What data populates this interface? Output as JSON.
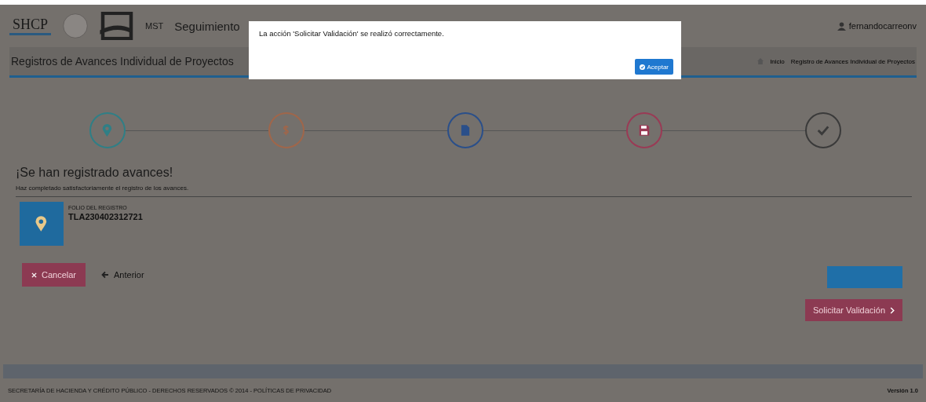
{
  "header": {
    "logos": [
      "SHCP",
      "MST"
    ],
    "app_title": "Seguimiento",
    "user": "fernandocarreonv"
  },
  "page": {
    "title": "Registros de Avances Individual de Proyectos",
    "breadcrumb": [
      "Inicio",
      "Registro de Avances Individual de Proyectos"
    ]
  },
  "steps": [
    {
      "kind": "marker",
      "color": "#2f7f86"
    },
    {
      "kind": "dollar",
      "color": "#a0664a"
    },
    {
      "kind": "document",
      "color": "#2a4f8a"
    },
    {
      "kind": "save",
      "color": "#9a3a55"
    },
    {
      "kind": "check",
      "color": "#3a3a3a"
    }
  ],
  "result": {
    "heading": "¡Se han registrado avances!",
    "message": "Haz completado satisfactoriamente el registro de los avances.",
    "folio_label": "FOLIO DEL REGISTRO",
    "folio": "TLA230402312721"
  },
  "buttons": [
    {
      "kind": "cancel",
      "label": "Cancelar"
    },
    {
      "kind": "back",
      "label": "Anterior"
    },
    {
      "kind": "primary"
    },
    {
      "kind": "validate",
      "label": "Solicitar Validación"
    }
  ],
  "footer": {
    "text": "SECRETARÍA DE HACIENDA Y CRÉDITO PÚBLICO - DERECHOS RESERVADOS © 2014 - POLÍTICAS DE PRIVACIDAD",
    "version": "Versión 1.0"
  },
  "modal": {
    "message": "La acción 'Solicitar Validación' se realizó correctamente.",
    "button": "Aceptar"
  }
}
